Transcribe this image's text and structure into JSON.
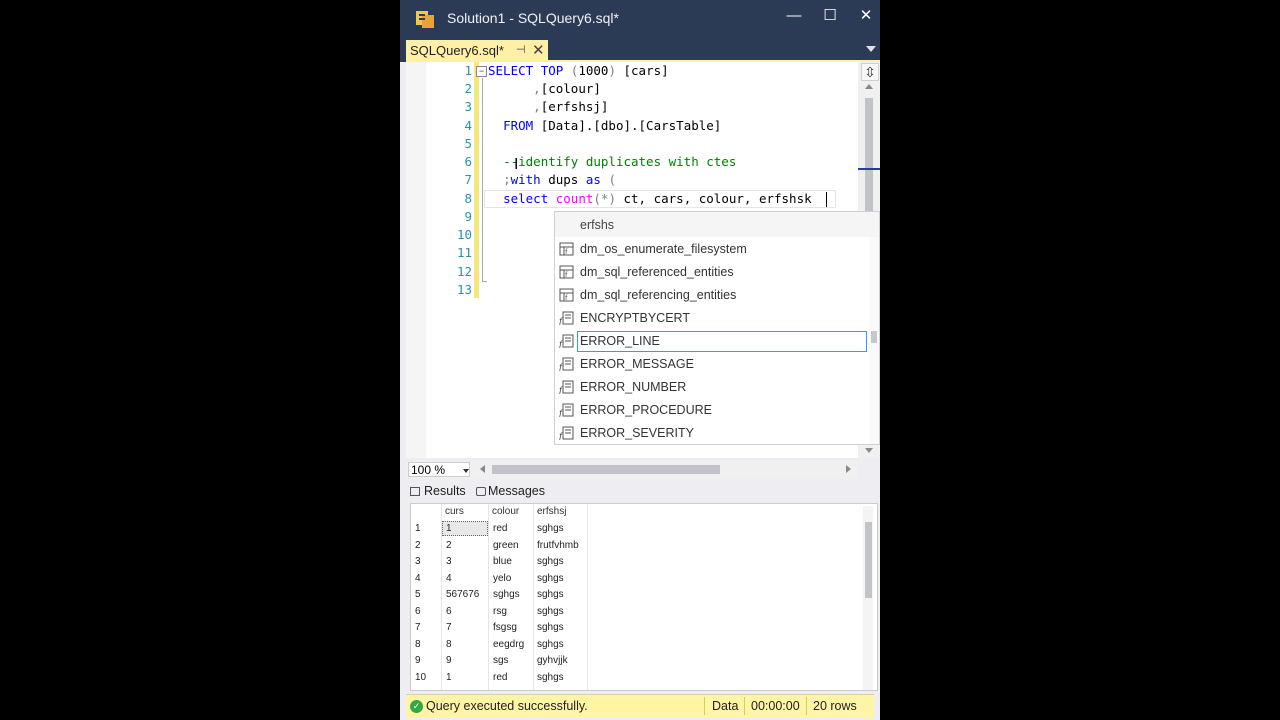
{
  "window": {
    "title": "Solution1 - SQLQuery6.sql*",
    "minimize": "—",
    "maximize": "☐",
    "close": "✕"
  },
  "tab": {
    "label": "SQLQuery6.sql*",
    "pin": "⊣",
    "close": "✕"
  },
  "editor": {
    "line_numbers": [
      "1",
      "2",
      "3",
      "4",
      "5",
      "6",
      "7",
      "8",
      "9",
      "10",
      "11",
      "12",
      "13"
    ],
    "lines": {
      "l1_kw1": "SELECT",
      "l1_kw2": "TOP",
      "l1_gr1": "(",
      "l1_num": "1000",
      "l1_gr2": ")",
      "l1_rest": "[cars]",
      "l2_gr": ",",
      "l2_rest": "[colour]",
      "l3_gr": ",",
      "l3_rest": "[erfshsj]",
      "l4_kw": "FROM",
      "l4_rest": "[Data].[dbo].[CarsTable]",
      "l6_comment": "--identify duplicates with ctes",
      "l7_gr": ";",
      "l7_kw1": "with",
      "l7_mid": " dups ",
      "l7_kw2": "as",
      "l7_gr2": " (",
      "l8_kw": "select",
      "l8_fn": "count",
      "l8_gr": "(*)",
      "l8_rest": " ct, cars, colour, erfshsk"
    }
  },
  "intellisense": {
    "filter": "erfshs",
    "items": [
      {
        "label": "dm_os_enumerate_filesystem",
        "icon": "table-function-icon"
      },
      {
        "label": "dm_sql_referenced_entities",
        "icon": "table-function-icon"
      },
      {
        "label": "dm_sql_referencing_entities",
        "icon": "table-function-icon"
      },
      {
        "label": "ENCRYPTBYCERT",
        "icon": "scalar-function-icon"
      },
      {
        "label": "ERROR_LINE",
        "icon": "scalar-function-icon",
        "selected": true
      },
      {
        "label": "ERROR_MESSAGE",
        "icon": "scalar-function-icon"
      },
      {
        "label": "ERROR_NUMBER",
        "icon": "scalar-function-icon"
      },
      {
        "label": "ERROR_PROCEDURE",
        "icon": "scalar-function-icon"
      },
      {
        "label": "ERROR_SEVERITY",
        "icon": "scalar-function-icon"
      }
    ]
  },
  "zoom": {
    "value": "100 %"
  },
  "results": {
    "tabs": {
      "results": "Results",
      "messages": "Messages"
    },
    "columns": [
      "curs",
      "colour",
      "erfshsj"
    ],
    "rows": [
      [
        "1",
        "1",
        "red",
        "sghgs"
      ],
      [
        "2",
        "2",
        "green",
        "frutfvhmb"
      ],
      [
        "3",
        "3",
        "blue",
        "sghgs"
      ],
      [
        "4",
        "4",
        "yelo",
        "sghgs"
      ],
      [
        "5",
        "567676",
        "sghgs",
        "sghgs"
      ],
      [
        "6",
        "6",
        "rsg",
        "sghgs"
      ],
      [
        "7",
        "7",
        "fsgsg",
        "sghgs"
      ],
      [
        "8",
        "8",
        "eegdrg",
        "sghgs"
      ],
      [
        "9",
        "9",
        "sgs",
        "gyhvjjk"
      ],
      [
        "10",
        "1",
        "red",
        "sghgs"
      ]
    ]
  },
  "status": {
    "message": "Query executed successfully.",
    "mode": "Data",
    "elapsed": "00:00:00",
    "rows": "20 rows"
  },
  "colors": {
    "titlebar": "#2b3a55",
    "tab_active": "#fff0a8",
    "statusbar": "#fff5a4",
    "keyword": "#0000ff",
    "function": "#ff00ff",
    "comment": "#008000",
    "line_number": "#2b91af"
  }
}
